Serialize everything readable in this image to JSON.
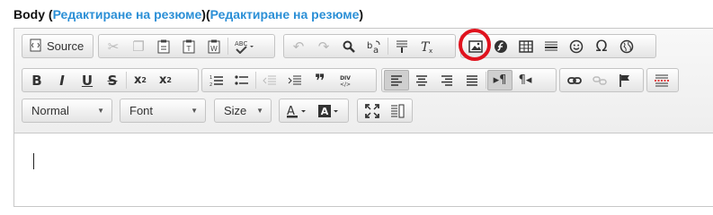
{
  "field_label": {
    "prefix": "Body (",
    "link1": "Редактиране на резюме",
    "middle": ")(",
    "link2": "Редактиране на резюме",
    "suffix": ")"
  },
  "toolbar": {
    "source_label": "Source",
    "format_combo": "Normal",
    "font_combo": "Font",
    "size_combo": "Size"
  },
  "colors": {
    "link": "#2b8fd6",
    "highlight_circle": "#e0121d"
  }
}
